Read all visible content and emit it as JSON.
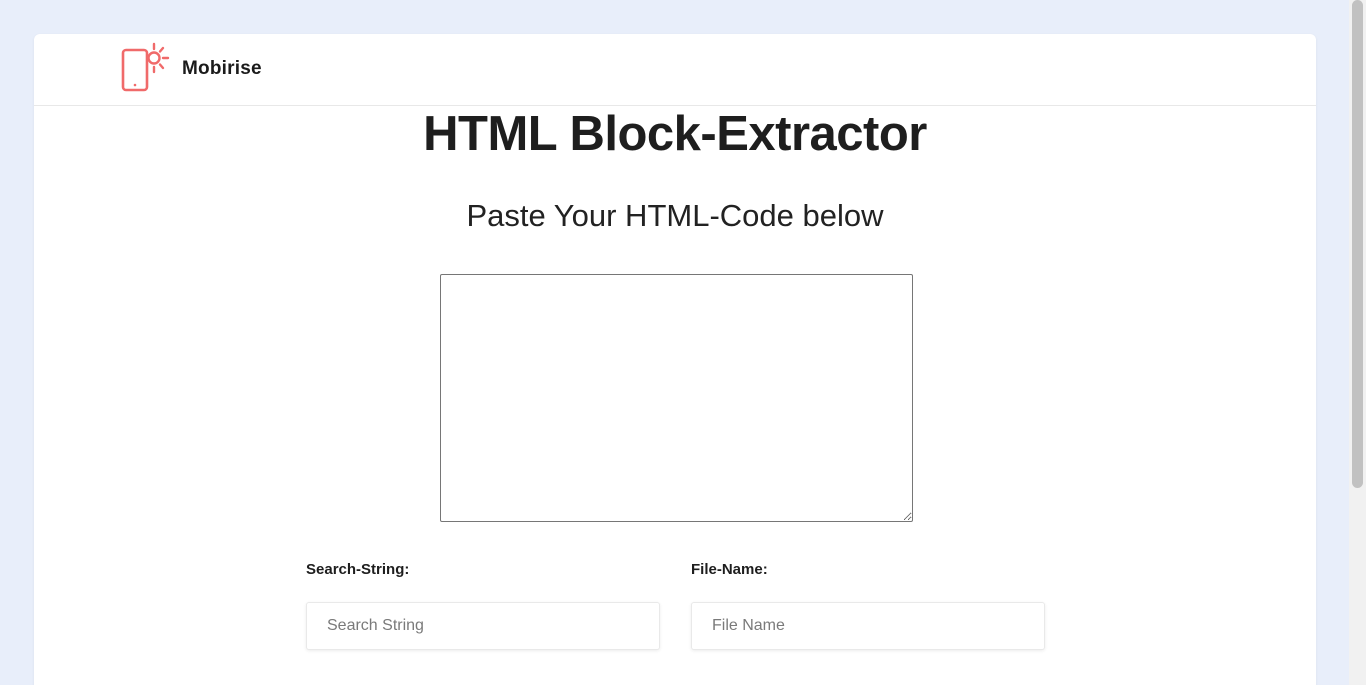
{
  "navbar": {
    "brand_name": "Mobirise",
    "logo_icon": "phone-sun-icon",
    "logo_color": "#f06a6a"
  },
  "main": {
    "title": "HTML Block-Extractor",
    "subtitle": "Paste Your HTML-Code below",
    "code_input": {
      "value": "",
      "placeholder": ""
    },
    "search_field": {
      "label": "Search-String:",
      "placeholder": "Search String",
      "value": ""
    },
    "file_field": {
      "label": "File-Name:",
      "placeholder": "File Name",
      "value": ""
    }
  },
  "colors": {
    "page_background": "#e8eefa",
    "card_background": "#ffffff",
    "text": "#1e1e1e"
  }
}
